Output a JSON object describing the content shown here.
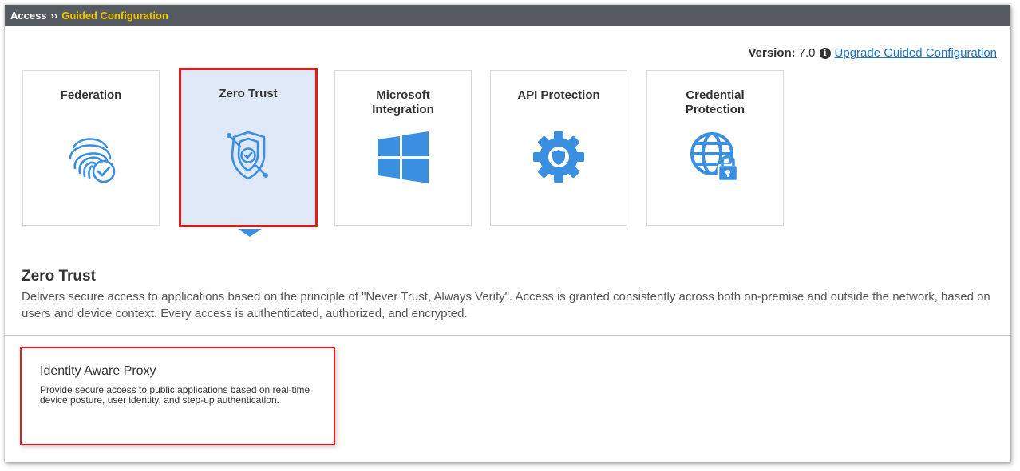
{
  "breadcrumb": {
    "root": "Access",
    "separator": "››",
    "current": "Guided Configuration"
  },
  "version": {
    "label": "Version:",
    "value": "7.0",
    "info_icon": "info-circle-icon",
    "upgrade_link": "Upgrade Guided Configuration"
  },
  "tiles": [
    {
      "title": "Federation",
      "icon": "fingerprint-check-icon",
      "selected": false
    },
    {
      "title": "Zero Trust",
      "icon": "shield-check-icon",
      "selected": true
    },
    {
      "title": "Microsoft\nIntegration",
      "icon": "windows-logo-icon",
      "selected": false
    },
    {
      "title": "API Protection",
      "icon": "gear-shield-icon",
      "selected": false
    },
    {
      "title": "Credential\nProtection",
      "icon": "globe-lock-icon",
      "selected": false
    }
  ],
  "section": {
    "title": "Zero Trust",
    "description": "Delivers secure access to applications based on the principle of \"Never Trust, Always Verify\". Access is granted consistently across both on-premise and outside the network, based on users and device context. Every access is authenticated, authorized, and encrypted."
  },
  "options": [
    {
      "title": "Identity Aware Proxy",
      "description": "Provide secure access to public applications based on real-time device posture, user identity, and step-up authentication."
    }
  ],
  "colors": {
    "topbar": "#555a60",
    "breadcrumb_current": "#f5c400",
    "icon_blue": "#3b8fe0",
    "selected_bg": "#dfe8f6",
    "highlight_red": "#e31b1b",
    "link": "#1a73c8"
  }
}
